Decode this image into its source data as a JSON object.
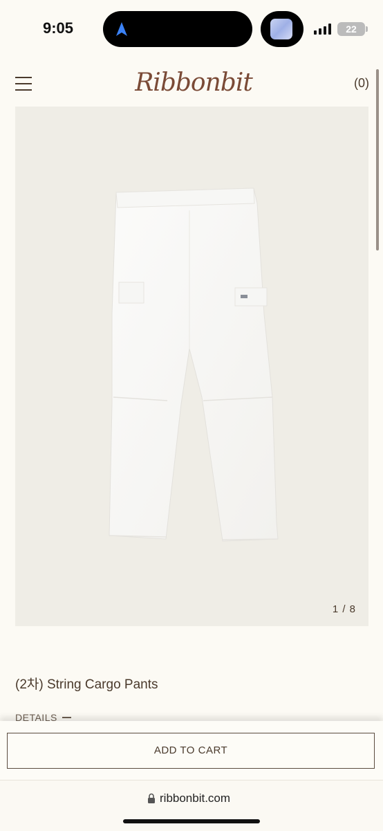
{
  "status": {
    "time": "9:05",
    "battery": "22"
  },
  "header": {
    "brand": "Ribbonbit",
    "cart_count": "(0)"
  },
  "gallery": {
    "counter": "1 / 8"
  },
  "product": {
    "title": "(2차) String Cargo Pants",
    "details_label": "DETAILS"
  },
  "actions": {
    "add_to_cart": "ADD TO CART"
  },
  "browser": {
    "url": "ribbonbit.com"
  },
  "colors": {
    "background": "#fcfaf4",
    "brand": "#7a4a36",
    "text": "#4a3a2c",
    "image_bg": "#efede6"
  },
  "icons": [
    "navigation-arrow-icon",
    "signal-icon",
    "battery-icon",
    "menu-icon",
    "lock-icon",
    "minus-icon"
  ]
}
